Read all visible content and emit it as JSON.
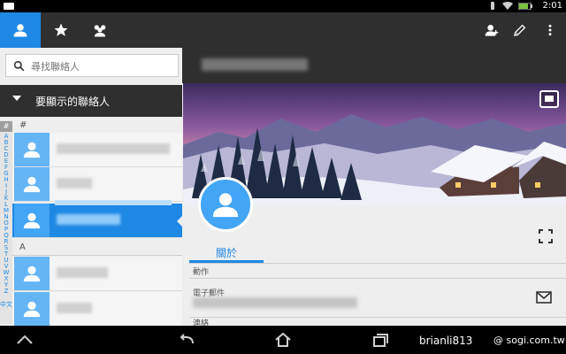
{
  "status_bar": {
    "time": "2:01"
  },
  "search": {
    "placeholder": "尋找聯絡人"
  },
  "filter": {
    "label": "要顯示的聯絡人"
  },
  "index": {
    "hash": "#",
    "letters": [
      "A",
      "B",
      "C",
      "D",
      "E",
      "F",
      "G",
      "H",
      "I",
      "J",
      "K",
      "L",
      "M",
      "N",
      "O",
      "P",
      "Q",
      "R",
      "S",
      "T",
      "U",
      "V",
      "W",
      "X",
      "Y",
      "Z"
    ],
    "chinese": "中文"
  },
  "contact_list": {
    "sections": [
      {
        "header": "#"
      },
      {
        "header": "A"
      }
    ]
  },
  "detail": {
    "tab_about": "關於",
    "actions_header": "動作",
    "email_label": "電子郵件",
    "next_header": "連絡"
  },
  "watermark": {
    "user": "brianli813",
    "site": "@ sogi.com.tw"
  },
  "colors": {
    "accent": "#1e88e5",
    "bar": "#2f2f2f",
    "avatar": "#64b5f6"
  }
}
